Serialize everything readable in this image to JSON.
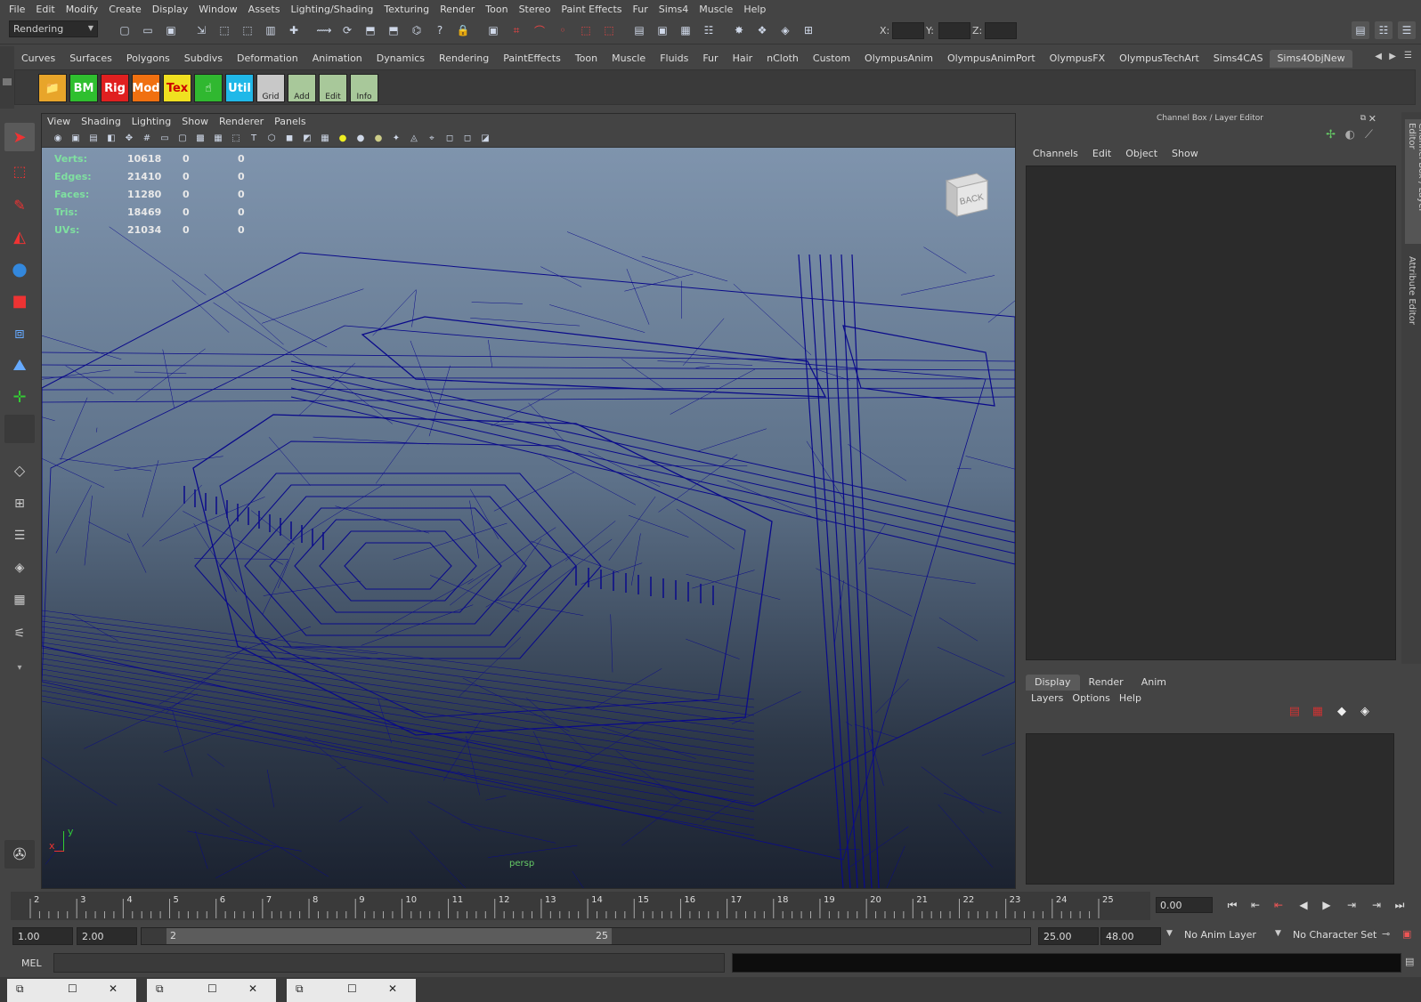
{
  "menubar": [
    "File",
    "Edit",
    "Modify",
    "Create",
    "Display",
    "Window",
    "Assets",
    "Lighting/Shading",
    "Texturing",
    "Render",
    "Toon",
    "Stereo",
    "Paint Effects",
    "Fur",
    "Sims4",
    "Muscle",
    "Help"
  ],
  "status": {
    "mode": "Rendering",
    "x_label": "X:",
    "y_label": "Y:",
    "z_label": "Z:"
  },
  "shelf": {
    "tabs": [
      "Curves",
      "Surfaces",
      "Polygons",
      "Subdivs",
      "Deformation",
      "Animation",
      "Dynamics",
      "Rendering",
      "PaintEffects",
      "Toon",
      "Muscle",
      "Fluids",
      "Fur",
      "Hair",
      "nCloth",
      "Custom",
      "OlympusAnim",
      "OlympusAnimPort",
      "OlympusFX",
      "OlympusTechArt",
      "Sims4CAS",
      "Sims4ObjNew"
    ],
    "active_tab": "Sims4ObjNew",
    "buttons": [
      {
        "label": "",
        "name": "folder-button",
        "color": "#e8a52a"
      },
      {
        "label": "BM",
        "name": "bm-button",
        "color": "#2fbf2f"
      },
      {
        "label": "Rig",
        "name": "rig-button",
        "color": "#e02020"
      },
      {
        "label": "Mod",
        "name": "mod-button",
        "color": "#f07010"
      },
      {
        "label": "Tex",
        "name": "tex-button",
        "color": "#f0e020"
      },
      {
        "label": "",
        "name": "hand-button",
        "color": "#30b830"
      },
      {
        "label": "Util",
        "name": "util-button",
        "color": "#20b8e8"
      },
      {
        "label": "Grid",
        "name": "grid-button",
        "color": "#c8c8c8"
      },
      {
        "label": "Add",
        "name": "add-button",
        "color": "#a8c89a"
      },
      {
        "label": "Edit",
        "name": "edit-button",
        "color": "#a8c89a"
      },
      {
        "label": "Info",
        "name": "info-button",
        "color": "#a8c89a"
      }
    ]
  },
  "viewport": {
    "menu": [
      "View",
      "Shading",
      "Lighting",
      "Show",
      "Renderer",
      "Panels"
    ],
    "hud": [
      {
        "label": "Verts:",
        "v1": "10618",
        "v2": "0",
        "v3": "0"
      },
      {
        "label": "Edges:",
        "v1": "21410",
        "v2": "0",
        "v3": "0"
      },
      {
        "label": "Faces:",
        "v1": "11280",
        "v2": "0",
        "v3": "0"
      },
      {
        "label": "Tris:",
        "v1": "18469",
        "v2": "0",
        "v3": "0"
      },
      {
        "label": "UVs:",
        "v1": "21034",
        "v2": "0",
        "v3": "0"
      }
    ],
    "viewcube_label": "BACK",
    "camera_label": "persp",
    "axis_x": "x",
    "axis_y": "y"
  },
  "channel_box": {
    "title": "Channel Box / Layer Editor",
    "menu": [
      "Channels",
      "Edit",
      "Object",
      "Show"
    ]
  },
  "layer_editor": {
    "tabs": [
      "Display",
      "Render",
      "Anim"
    ],
    "active_tab": "Display",
    "menu": [
      "Layers",
      "Options",
      "Help"
    ]
  },
  "side_tabs": [
    "Channel Box / Layer Editor",
    "Attribute Editor"
  ],
  "time_slider": {
    "ticks": [
      "2",
      "3",
      "4",
      "5",
      "6",
      "7",
      "8",
      "9",
      "10",
      "11",
      "12",
      "13",
      "14",
      "15",
      "16",
      "17",
      "18",
      "19",
      "20",
      "21",
      "22",
      "23",
      "24",
      "25"
    ],
    "current_time": "0.00"
  },
  "range": {
    "start": "1.00",
    "playback_start": "2.00",
    "handle_start": "2",
    "handle_end": "25",
    "playback_end": "25.00",
    "end": "48.00",
    "anim_layer": "No Anim Layer",
    "character_set": "No Character Set"
  },
  "command_line": {
    "label": "MEL"
  },
  "taskbar_windows": 3,
  "colors": {
    "wireframe": "#0a0a8a",
    "hud_label": "#7fe0a0",
    "accent": "#5a5a5a"
  }
}
